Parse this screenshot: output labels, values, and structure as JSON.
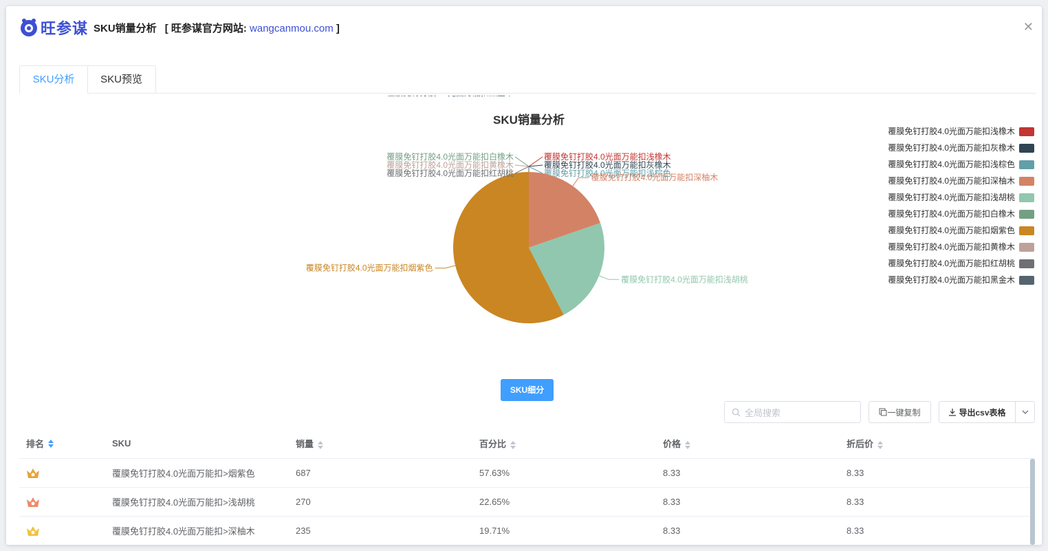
{
  "header": {
    "logo_text": "旺参谋",
    "title": "SKU销量分析",
    "site_prefix": "[ 旺参谋官方网站: ",
    "site_url": "wangcanmou.com",
    "site_suffix": " ]"
  },
  "tabs": [
    {
      "label": "SKU分析",
      "active": true
    },
    {
      "label": "SKU预览",
      "active": false
    }
  ],
  "detail_button": "SKU细分",
  "toolbar": {
    "search_placeholder": "全局搜索",
    "copy_label": "一键复制",
    "export_label": "导出csv表格"
  },
  "table": {
    "columns": [
      "排名",
      "SKU",
      "销量",
      "百分比",
      "价格",
      "折后价"
    ],
    "rows": [
      {
        "rank_icon": "crown-gold-icon",
        "sku": "覆膜免钉打胶4.0光面万能扣>烟紫色",
        "sales": "687",
        "percent": "57.63%",
        "price": "8.33",
        "discount": "8.33"
      },
      {
        "rank_icon": "crown-salmon-icon",
        "sku": "覆膜免钉打胶4.0光面万能扣>浅胡桃",
        "sales": "270",
        "percent": "22.65%",
        "price": "8.33",
        "discount": "8.33"
      },
      {
        "rank_icon": "crown-yellow-icon",
        "sku": "覆膜免钉打胶4.0光面万能扣>深柚木",
        "sales": "235",
        "percent": "19.71%",
        "price": "8.33",
        "discount": "8.33"
      }
    ]
  },
  "chart_data": {
    "type": "pie",
    "title": "SKU销量分析",
    "legend_position": "right",
    "slices": [
      {
        "name": "覆膜免钉打胶4.0光面万能扣浅橡木",
        "value": 0,
        "color": "#c23531"
      },
      {
        "name": "覆膜免钉打胶4.0光面万能扣灰橡木",
        "value": 0,
        "color": "#2f4554"
      },
      {
        "name": "覆膜免钉打胶4.0光面万能扣浅棕色",
        "value": 0,
        "color": "#61a0a8"
      },
      {
        "name": "覆膜免钉打胶4.0光面万能扣深柚木",
        "value": 235,
        "color": "#d48265"
      },
      {
        "name": "覆膜免钉打胶4.0光面万能扣浅胡桃",
        "value": 270,
        "color": "#91c7ae"
      },
      {
        "name": "覆膜免钉打胶4.0光面万能扣白橡木",
        "value": 0,
        "color": "#749f83"
      },
      {
        "name": "覆膜免钉打胶4.0光面万能扣烟紫色",
        "value": 687,
        "color": "#ca8622"
      },
      {
        "name": "覆膜免钉打胶4.0光面万能扣黄橡木",
        "value": 0,
        "color": "#bda29a"
      },
      {
        "name": "覆膜免钉打胶4.0光面万能扣红胡桃",
        "value": 0,
        "color": "#6e7074"
      },
      {
        "name": "覆膜免钉打胶4.0光面万能扣黑金木",
        "value": 0,
        "color": "#546570"
      }
    ]
  }
}
